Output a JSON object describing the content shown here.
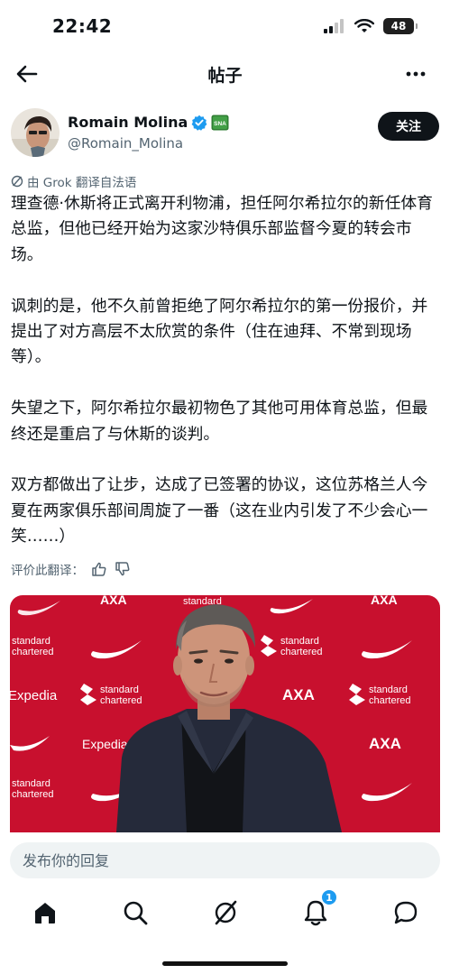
{
  "status": {
    "time": "22:42",
    "battery": "48"
  },
  "nav": {
    "title": "帖子"
  },
  "author": {
    "name": "Romain Molina",
    "handle": "@Romain_Molina",
    "follow_label": "关注",
    "badge_text": "SNA"
  },
  "translation_note": "由 Grok 翻译自法语",
  "paragraphs": [
    "理查德·休斯将正式离开利物浦，担任阿尔希拉尔的新任体育总监，但他已经开始为这家沙特俱乐部监督今夏的转会市场。",
    "讽刺的是，他不久前曾拒绝了阿尔希拉尔的第一份报价，并提出了对方高层不太欣赏的条件（住在迪拜、不常到现场等）。",
    "失望之下，阿尔希拉尔最初物色了其他可用体育总监，但最终还是重启了与休斯的谈判。",
    "双方都做出了让步，达成了已签署的协议，这位苏格兰人今夏在两家俱乐部间周旋了一番（这在业内引发了不少会心一笑……）"
  ],
  "rate_label": "评价此翻译：",
  "media": {
    "sponsors": {
      "standard1": "standard",
      "standard2": "chartered",
      "expedia": "Expedia",
      "axa": "AXA"
    }
  },
  "reply": {
    "placeholder": "发布你的回复"
  },
  "tabs": {
    "notification_count": "1"
  },
  "colors": {
    "accent": "#1d9bf0",
    "backdrop": "#c8102e",
    "text": "#0f1419",
    "muted": "#536471"
  }
}
